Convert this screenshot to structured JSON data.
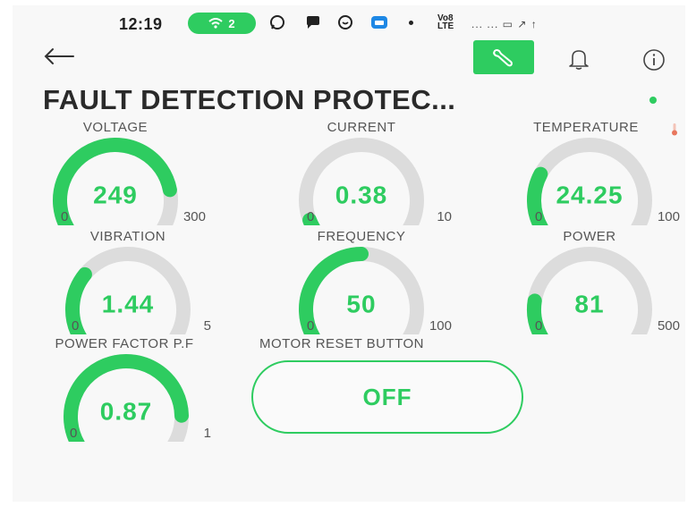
{
  "status_bar": {
    "time": "12:19",
    "wifi_count": "2",
    "network_label": "Vo8\nLTE",
    "trail": "... ... ▭ ↗ ↑"
  },
  "header": {
    "title": "FAULT DETECTION PROTEC...",
    "online": true,
    "accent_color": "#2ecc60"
  },
  "widgets": [
    {
      "label": "VOLTAGE",
      "value": "249",
      "min": "0",
      "max": "300",
      "fraction": 0.83
    },
    {
      "label": "CURRENT",
      "value": "0.38",
      "min": "0",
      "max": "10",
      "fraction": 0.038
    },
    {
      "label": "TEMPERATURE",
      "value": "24.25",
      "min": "0",
      "max": "100",
      "fraction": 0.2425,
      "label_icon": "thermometer-icon"
    },
    {
      "label": "VIBRATION",
      "value": "1.44",
      "min": "0",
      "max": "5",
      "fraction": 0.288
    },
    {
      "label": "FREQUENCY",
      "value": "50",
      "min": "0",
      "max": "100",
      "fraction": 0.5
    },
    {
      "label": "POWER",
      "value": "81",
      "min": "0",
      "max": "500",
      "fraction": 0.162
    },
    {
      "label": "POWER FACTOR P.F",
      "value": "0.87",
      "min": "0",
      "max": "1",
      "fraction": 0.87
    }
  ],
  "reset": {
    "label": "MOTOR RESET BUTTON",
    "state": "OFF"
  }
}
